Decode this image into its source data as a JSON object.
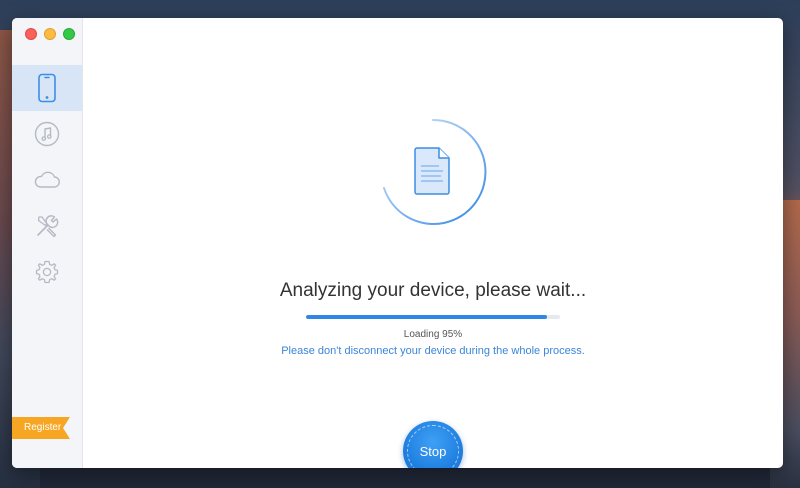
{
  "sidebar": {
    "items": [
      {
        "name": "device",
        "icon": "phone-icon",
        "active": true
      },
      {
        "name": "itunes",
        "icon": "music-note-icon",
        "active": false
      },
      {
        "name": "icloud",
        "icon": "cloud-icon",
        "active": false
      },
      {
        "name": "tools",
        "icon": "tools-icon",
        "active": false
      },
      {
        "name": "settings",
        "icon": "gear-icon",
        "active": false
      }
    ],
    "register_label": "Register"
  },
  "main": {
    "title": "Analyzing your device, please wait...",
    "progress_percent": 95,
    "loading_text": "Loading 95%",
    "notice": "Please don't disconnect your device during the whole process.",
    "stop_label": "Stop"
  },
  "colors": {
    "accent": "#2f86e6",
    "active_nav_bg": "#d7e5f7",
    "register_bg": "#f6a623",
    "notice_text": "#3a86d8"
  }
}
